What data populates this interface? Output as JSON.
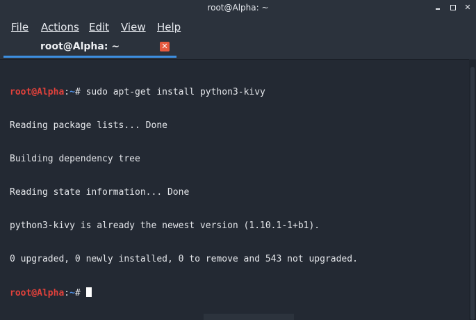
{
  "window": {
    "title": "root@Alpha: ~",
    "controls": {
      "minimize": "minimize-icon",
      "maximize": "maximize-icon",
      "close": "close-icon",
      "close_glyph": "✕"
    }
  },
  "menu": {
    "items": [
      {
        "label": "File"
      },
      {
        "label": "Actions"
      },
      {
        "label": "Edit"
      },
      {
        "label": "View"
      },
      {
        "label": "Help"
      }
    ]
  },
  "tab": {
    "label": "root@Alpha: ~",
    "close_glyph": "✕"
  },
  "terminal": {
    "prompt": {
      "user": "root@Alpha",
      "sep": ":",
      "path": "~",
      "hash": "# "
    },
    "command": "sudo apt-get install python3-kivy",
    "output": [
      "Reading package lists... Done",
      "Building dependency tree",
      "Reading state information... Done",
      "python3-kivy is already the newest version (1.10.1-1+b1).",
      "0 upgraded, 0 newly installed, 0 to remove and 543 not upgraded."
    ]
  },
  "colors": {
    "background": "#232933",
    "prompt_user": "#e0413b",
    "prompt_path": "#4f8ee0",
    "tab_accent": "#3d8fe0",
    "tab_close": "#e75a3f"
  }
}
